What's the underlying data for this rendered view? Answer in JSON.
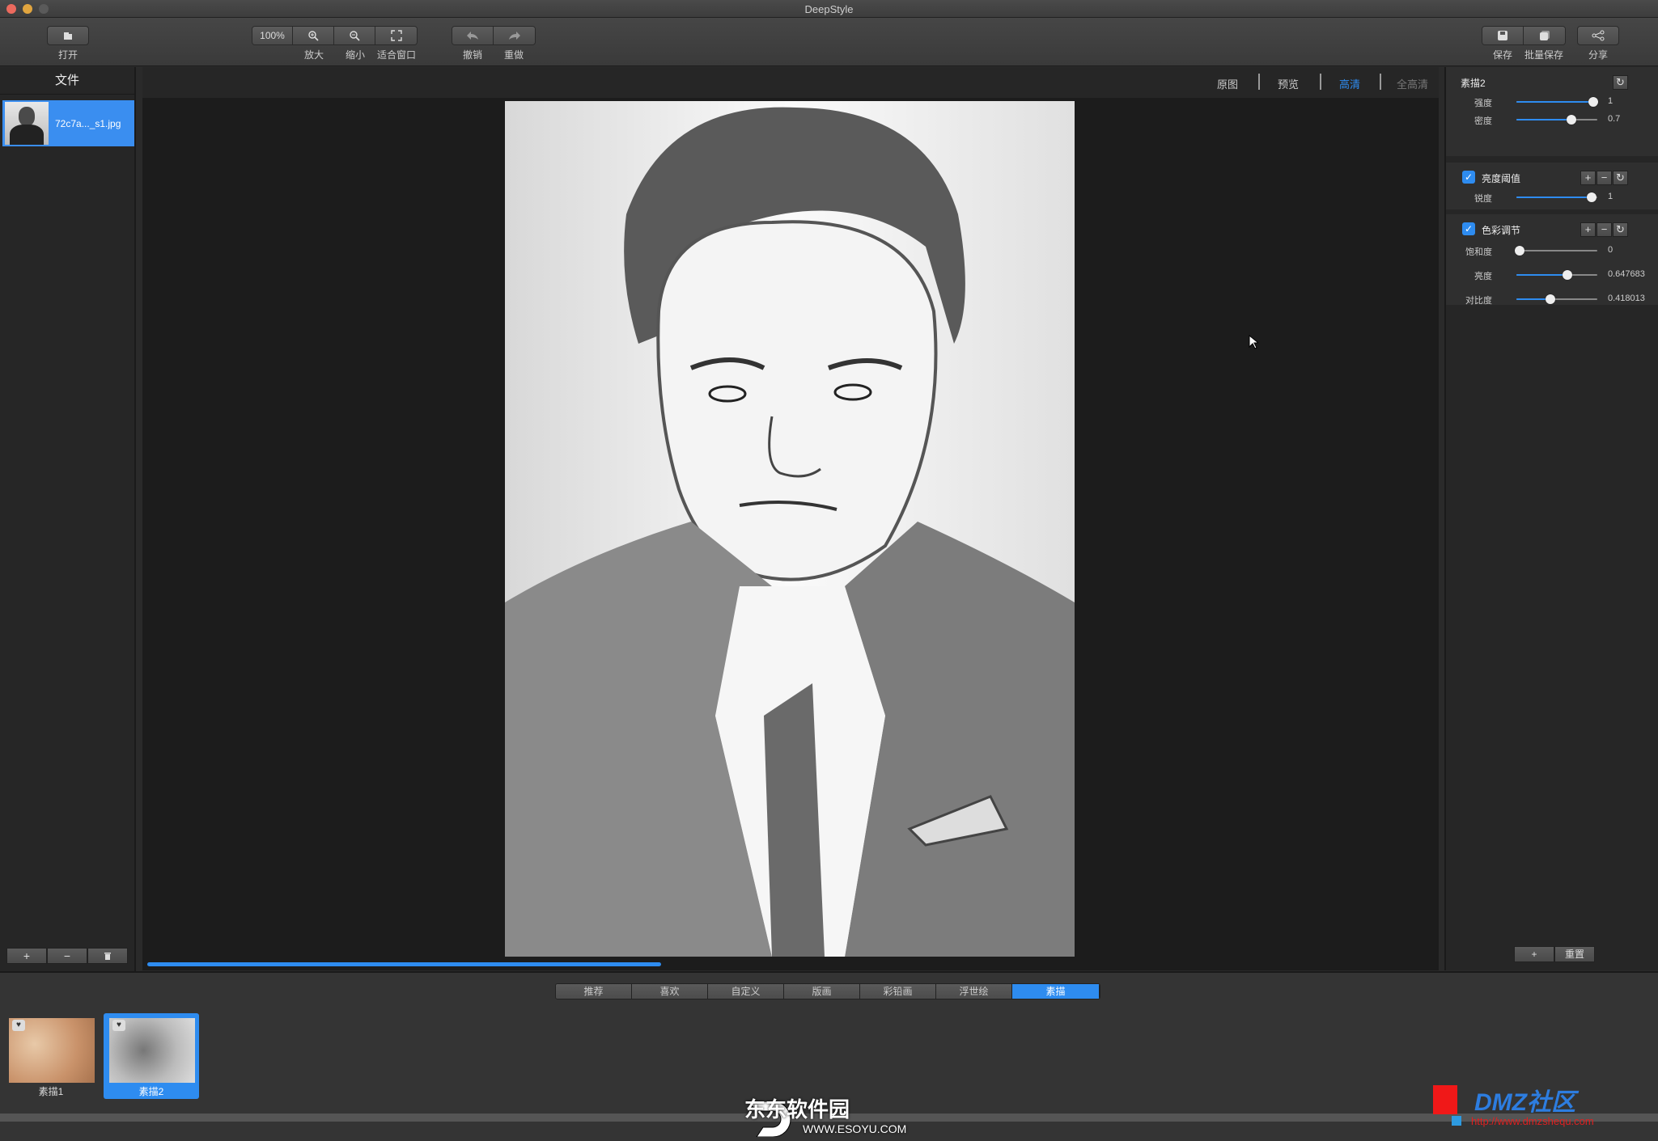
{
  "app": {
    "title": "DeepStyle"
  },
  "toolbar": {
    "open": "打开",
    "zoom_value": "100%",
    "zoom_in": "放大",
    "zoom_out": "缩小",
    "fit": "适合窗口",
    "undo": "撤销",
    "redo": "重做",
    "save": "保存",
    "batch_save": "批量保存",
    "share": "分享"
  },
  "files": {
    "header": "文件",
    "items": [
      {
        "name": "72c7a..._s1.jpg",
        "selected": true
      }
    ]
  },
  "view_tabs": [
    {
      "label": "原图"
    },
    {
      "label": "预览"
    },
    {
      "label": "高清",
      "active": true
    },
    {
      "label": "全高清",
      "disabled": true
    }
  ],
  "progress": 0.45,
  "panel": {
    "style_name": "素描2",
    "intensity": {
      "label": "强度",
      "value": "1",
      "fraction": 0.95
    },
    "density": {
      "label": "密度",
      "value": "0.7",
      "fraction": 0.68
    },
    "brightness_threshold": {
      "title": "亮度阈值",
      "checked": true,
      "sharpness": {
        "label": "锐度",
        "value": "1",
        "fraction": 0.93
      }
    },
    "color_adjust": {
      "title": "色彩调节",
      "checked": true,
      "saturation": {
        "label": "饱和度",
        "value": "0",
        "fraction": 0.0
      },
      "brightness": {
        "label": "亮度",
        "value": "0.647683",
        "fraction": 0.63
      },
      "contrast": {
        "label": "对比度",
        "value": "0.418013",
        "fraction": 0.42
      }
    },
    "reset": "重置"
  },
  "style_tabs": [
    {
      "label": "推荐"
    },
    {
      "label": "喜欢"
    },
    {
      "label": "自定义"
    },
    {
      "label": "版画"
    },
    {
      "label": "彩铅画"
    },
    {
      "label": "浮世绘"
    },
    {
      "label": "素描",
      "active": true
    }
  ],
  "presets": [
    {
      "label": "素描1"
    },
    {
      "label": "素描2",
      "selected": true
    }
  ],
  "watermarks": {
    "left": "东东软件园",
    "left_url": "WWW.ESOYU.COM",
    "right": "DMZ社区",
    "right_url": "http://www.dmzshequ.com"
  },
  "colors": {
    "accent": "#2e8cf0",
    "bg": "#2a2a2a"
  }
}
